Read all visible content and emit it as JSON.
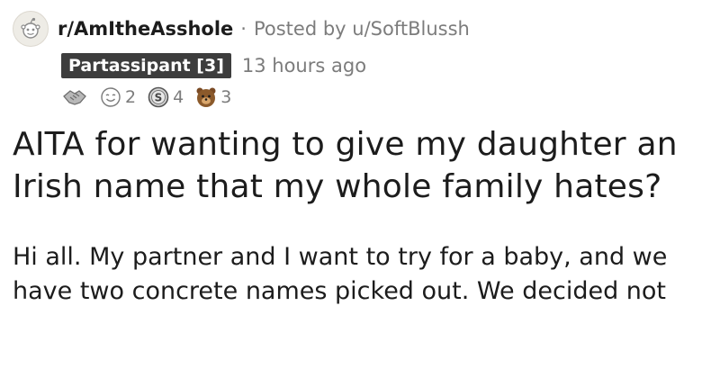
{
  "post": {
    "subreddit": "r/AmItheAsshole",
    "separator": "·",
    "posted_by": "Posted by u/SoftBlussh",
    "flair": "Partassipant [3]",
    "time": "13 hours ago",
    "awards": [
      {
        "icon": "handshake-award-icon",
        "count": ""
      },
      {
        "icon": "wholesome-award-icon",
        "count": "2"
      },
      {
        "icon": "silver-award-icon",
        "count": "4"
      },
      {
        "icon": "bear-award-icon",
        "count": "3"
      }
    ],
    "title": "AITA for wanting to give my daughter an Irish name that my whole family hates?",
    "body_lines": [
      "Hi all. My partner and I want to try for a baby, and we",
      "have two concrete names picked out. We decided not"
    ]
  }
}
